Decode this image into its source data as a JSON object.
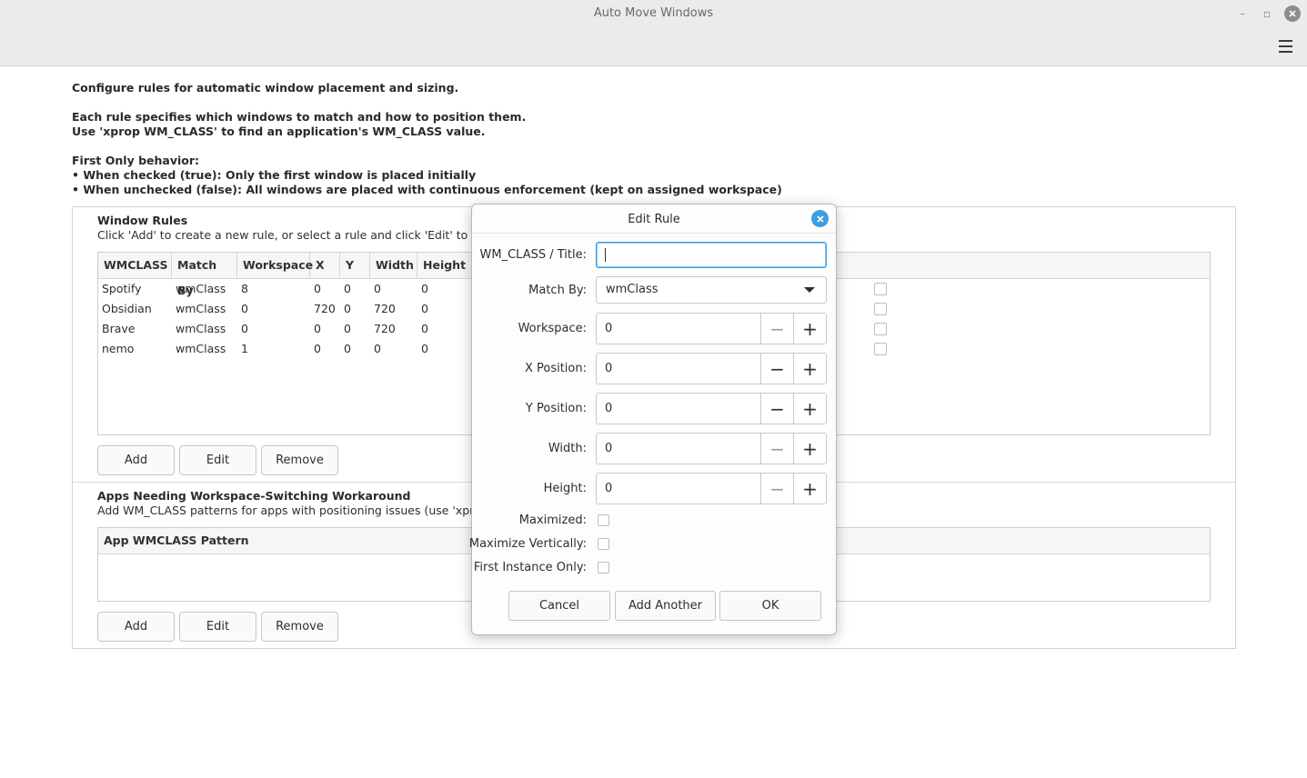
{
  "window": {
    "title": "Auto Move Windows",
    "minimize_glyph": "–",
    "maximize_glyph": "▫",
    "close_glyph": "✕"
  },
  "intro": {
    "line1": "Configure rules for automatic window placement and sizing.",
    "line2": "Each rule specifies which windows to match and how to position them.",
    "line3": "Use 'xprop WM_CLASS' to find an application's WM_CLASS value.",
    "line4": "First Only behavior:",
    "line5": "• When checked (true): Only the first window is placed initially",
    "line6": "• When unchecked (false): All windows are placed with continuous enforcement (kept on assigned workspace)"
  },
  "window_rules": {
    "title": "Window Rules",
    "description": "Click 'Add' to create a new rule, or select a rule and click 'Edit' to modif",
    "columns": [
      "WMCLASS",
      "Match By",
      "Workspace",
      "X",
      "Y",
      "Width",
      "Height"
    ],
    "rows": [
      {
        "wmclass": "Spotify",
        "match_by": "wmClass",
        "workspace": "8",
        "x": "0",
        "y": "0",
        "width": "0",
        "height": "0",
        "first_only": false
      },
      {
        "wmclass": "Obsidian",
        "match_by": "wmClass",
        "workspace": "0",
        "x": "720",
        "y": "0",
        "width": "720",
        "height": "0",
        "first_only": false
      },
      {
        "wmclass": "Brave",
        "match_by": "wmClass",
        "workspace": "0",
        "x": "0",
        "y": "0",
        "width": "720",
        "height": "0",
        "first_only": false
      },
      {
        "wmclass": "nemo",
        "match_by": "wmClass",
        "workspace": "1",
        "x": "0",
        "y": "0",
        "width": "0",
        "height": "0",
        "first_only": false
      }
    ],
    "add_label": "Add",
    "edit_label": "Edit",
    "remove_label": "Remove"
  },
  "workaround": {
    "title": "Apps Needing Workspace-Switching Workaround",
    "description": "Add WM_CLASS patterns for apps with positioning issues (use 'xprop",
    "column": "App WMCLASS Pattern",
    "add_label": "Add",
    "edit_label": "Edit",
    "remove_label": "Remove"
  },
  "dialog": {
    "title": "Edit Rule",
    "close_glyph": "✕",
    "wm_class_label": "WM_CLASS / Title:",
    "wm_class_value": "",
    "match_by_label": "Match By:",
    "match_by_value": "wmClass",
    "workspace_label": "Workspace:",
    "workspace_value": "0",
    "x_label": "X Position:",
    "x_value": "0",
    "y_label": "Y Position:",
    "y_value": "0",
    "width_label": "Width:",
    "width_value": "0",
    "height_label": "Height:",
    "height_value": "0",
    "maximized_label": "Maximized:",
    "maximized_checked": false,
    "max_vert_label": "Maximize Vertically:",
    "max_vert_checked": false,
    "first_instance_label": "First Instance Only:",
    "first_instance_checked": false,
    "minus_glyph": "−",
    "plus_glyph": "+",
    "cancel_label": "Cancel",
    "add_another_label": "Add Another",
    "ok_label": "OK"
  }
}
